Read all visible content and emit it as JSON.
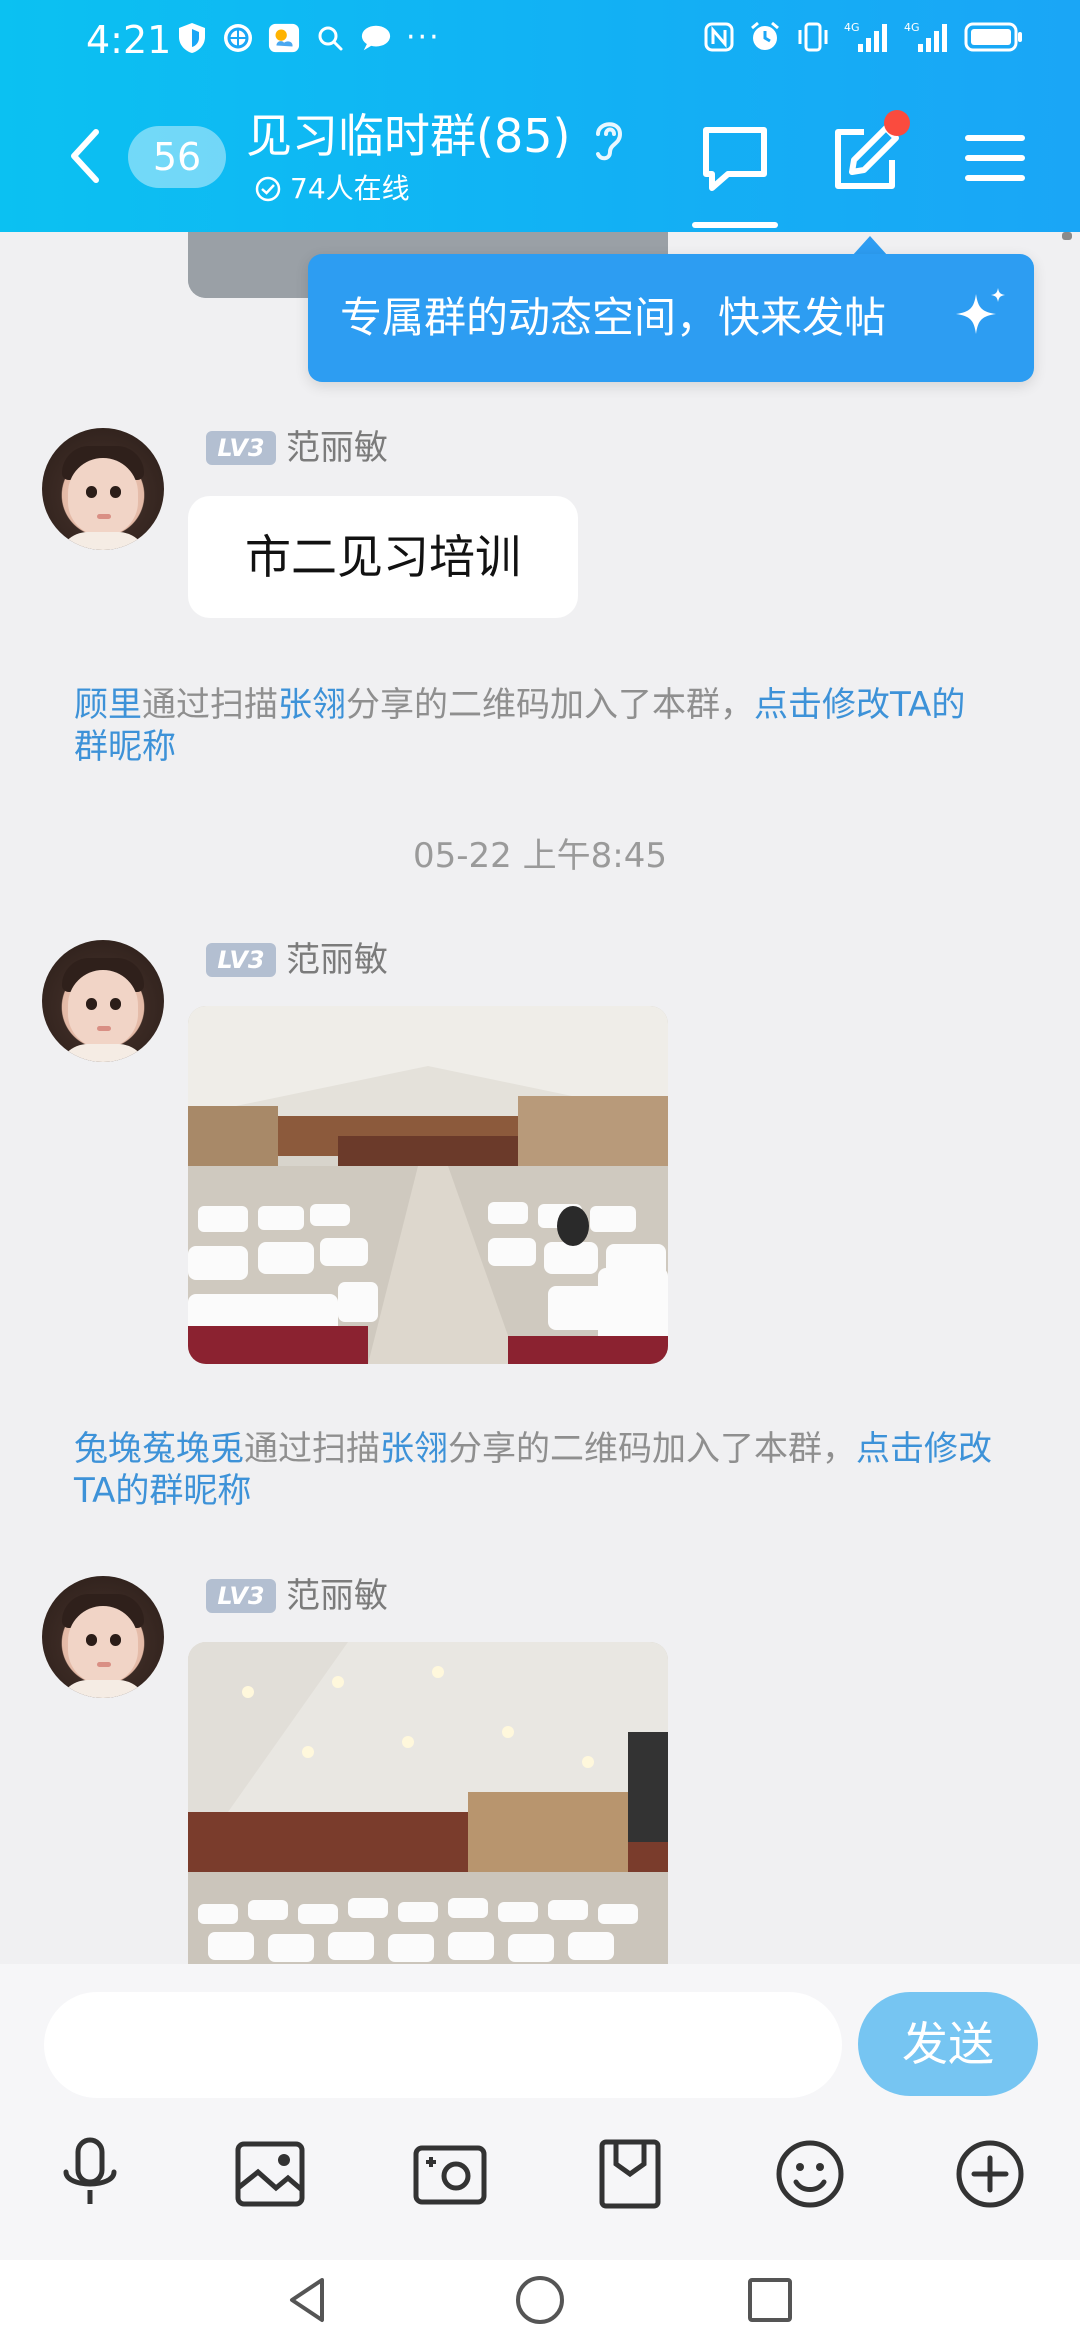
{
  "status_bar": {
    "time": "4:21",
    "left_icons": [
      "shield-icon",
      "browser-icon",
      "weather-icon",
      "search-icon",
      "message-icon"
    ],
    "more": "···",
    "right_icons": [
      "nfc-icon",
      "alarm-icon",
      "vibrate-icon",
      "signal-4g-icon",
      "signal-4g-icon",
      "battery-icon"
    ]
  },
  "header": {
    "unread_count": "56",
    "title": "见习临时群(85)",
    "online_text": "74人在线",
    "accent": "#12b1f4"
  },
  "tooltip": {
    "text": "专属群的动态空间，快来发帖"
  },
  "messages": {
    "msg1": {
      "level": "LV3",
      "sender": "范丽敏",
      "text": "市二见习培训"
    },
    "sys1": {
      "name": "顾里",
      "part1": "通过扫描",
      "sharer": "张翎",
      "part2": "分享的二维码加入了本群，",
      "link": "点击修改TA的群昵称"
    },
    "time_sep": "05-22 上午8:45",
    "msg2": {
      "level": "LV3",
      "sender": "范丽敏"
    },
    "sys2": {
      "name": "兔堍菟堍兎",
      "part1": "通过扫描",
      "sharer": "张翎",
      "part2": "分享的二维码加入了本群，",
      "link": "点击修改TA的群昵称"
    },
    "msg3": {
      "level": "LV3",
      "sender": "范丽敏"
    }
  },
  "input": {
    "value": "",
    "placeholder": "",
    "send_label": "发送"
  },
  "toolbar": [
    "mic-icon",
    "image-icon",
    "camera-icon",
    "file-icon",
    "emoji-icon",
    "plus-icon"
  ],
  "system_nav": [
    "back-icon",
    "home-icon",
    "recents-icon"
  ]
}
